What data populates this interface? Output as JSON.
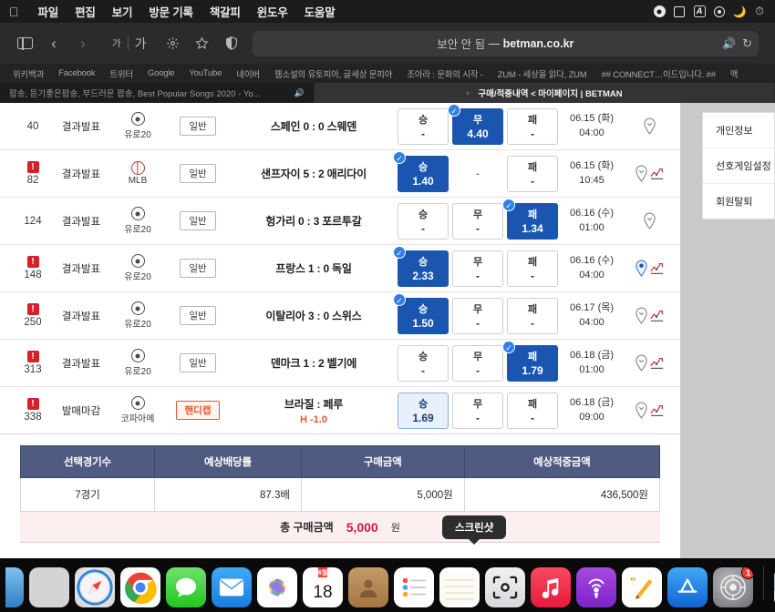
{
  "menubar": {
    "apple": "",
    "items": [
      "파일",
      "편집",
      "보기",
      "방문 기록",
      "책갈피",
      "윈도우",
      "도움말"
    ],
    "status_icons": [
      "record-icon",
      "screen-icon",
      "input-source-icon",
      "control-center-icon",
      "do-not-disturb-icon",
      "time-machine-icon"
    ]
  },
  "toolbar": {
    "sidebar_label": "사이드바",
    "back_label": "뒤로",
    "forward_label": "앞으로",
    "text_small": "가",
    "text_large": "가",
    "settings_label": "설정",
    "bookmark_label": "책갈피",
    "shield_label": "개인 정보 보호 리포트",
    "url_security": "보안 안 됨",
    "url_dash": "—",
    "url_domain": "betman.co.kr",
    "speaker_icon": "speaker-icon",
    "reload_icon": "reload-icon"
  },
  "bookmarks": [
    "위키백과",
    "Facebook",
    "트위터",
    "Google",
    "YouTube",
    "네이버",
    "웹소설의 유토피아, 글세상 문피아",
    "조아라 : 문화의 시작 -",
    "ZUM - 세상을 읽다, ZUM",
    "## CONNECT…이드입니다. ##",
    "맥"
  ],
  "tabs": [
    {
      "title": "팝송, 듣기좋은팝송, 부드러운 팝송, Best Popular Songs 2020 - Yo...",
      "active": false,
      "has_audio": true
    },
    {
      "title": "구매/적중내역 < 마이페이지 | BETMAN",
      "active": true,
      "has_audio": false
    }
  ],
  "match_rows": [
    {
      "no": "40",
      "alert": false,
      "status": "결과발표",
      "league": "유로20",
      "league_icon": "soccer-ball-icon",
      "type": "일반",
      "type_kind": "normal",
      "match": "스페인 0 : 0 스웨덴",
      "handicap": "",
      "odds": [
        {
          "label": "승",
          "value": "-",
          "state": "plain"
        },
        {
          "label": "무",
          "value": "4.40",
          "state": "selected"
        },
        {
          "label": "패",
          "value": "-",
          "state": "plain"
        }
      ],
      "date": "06.15 (화)",
      "time": "04:00",
      "actions": [
        "pin-icon"
      ]
    },
    {
      "no": "82",
      "alert": true,
      "status": "결과발표",
      "league": "MLB",
      "league_icon": "baseball-icon",
      "type": "일반",
      "type_kind": "normal",
      "match": "샌프자이 5 : 2 애리다이",
      "handicap": "",
      "odds": [
        {
          "label": "승",
          "value": "1.40",
          "state": "selected"
        },
        {
          "label": "",
          "value": "-",
          "state": "blank"
        },
        {
          "label": "패",
          "value": "-",
          "state": "plain"
        }
      ],
      "date": "06.15 (화)",
      "time": "10:45",
      "actions": [
        "pin-icon",
        "chart-icon"
      ]
    },
    {
      "no": "124",
      "alert": false,
      "status": "결과발표",
      "league": "유로20",
      "league_icon": "soccer-ball-icon",
      "type": "일반",
      "type_kind": "normal",
      "match": "헝가리 0 : 3 포르투갈",
      "handicap": "",
      "odds": [
        {
          "label": "승",
          "value": "-",
          "state": "plain"
        },
        {
          "label": "무",
          "value": "-",
          "state": "plain"
        },
        {
          "label": "패",
          "value": "1.34",
          "state": "selected"
        }
      ],
      "date": "06.16 (수)",
      "time": "01:00",
      "actions": [
        "pin-icon"
      ]
    },
    {
      "no": "148",
      "alert": true,
      "status": "결과발표",
      "league": "유로20",
      "league_icon": "soccer-ball-icon",
      "type": "일반",
      "type_kind": "normal",
      "match": "프랑스 1 : 0 독일",
      "handicap": "",
      "odds": [
        {
          "label": "승",
          "value": "2.33",
          "state": "selected"
        },
        {
          "label": "무",
          "value": "-",
          "state": "plain"
        },
        {
          "label": "패",
          "value": "-",
          "state": "plain"
        }
      ],
      "date": "06.16 (수)",
      "time": "04:00",
      "actions": [
        "pin-icon-active",
        "chart-icon"
      ]
    },
    {
      "no": "250",
      "alert": true,
      "status": "결과발표",
      "league": "유로20",
      "league_icon": "soccer-ball-icon",
      "type": "일반",
      "type_kind": "normal",
      "match": "이탈리아 3 : 0 스위스",
      "handicap": "",
      "odds": [
        {
          "label": "승",
          "value": "1.50",
          "state": "selected"
        },
        {
          "label": "무",
          "value": "-",
          "state": "plain"
        },
        {
          "label": "패",
          "value": "-",
          "state": "plain"
        }
      ],
      "date": "06.17 (목)",
      "time": "04:00",
      "actions": [
        "pin-icon",
        "chart-icon"
      ]
    },
    {
      "no": "313",
      "alert": true,
      "status": "결과발표",
      "league": "유로20",
      "league_icon": "soccer-ball-icon",
      "type": "일반",
      "type_kind": "normal",
      "match": "덴마크 1 : 2 벨기에",
      "handicap": "",
      "odds": [
        {
          "label": "승",
          "value": "-",
          "state": "plain"
        },
        {
          "label": "무",
          "value": "-",
          "state": "plain"
        },
        {
          "label": "패",
          "value": "1.79",
          "state": "selected"
        }
      ],
      "date": "06.18 (금)",
      "time": "01:00",
      "actions": [
        "pin-icon",
        "chart-icon"
      ]
    },
    {
      "no": "338",
      "alert": true,
      "status": "발매마감",
      "league": "코파아메",
      "league_icon": "soccer-ball-icon",
      "type": "핸디캡",
      "type_kind": "handicap",
      "match": "브라질 : 페루",
      "handicap": "H -1.0",
      "odds": [
        {
          "label": "승",
          "value": "1.69",
          "state": "soft"
        },
        {
          "label": "무",
          "value": "-",
          "state": "plain"
        },
        {
          "label": "패",
          "value": "-",
          "state": "plain"
        }
      ],
      "date": "06.18 (금)",
      "time": "09:00",
      "actions": [
        "pin-icon",
        "chart-icon"
      ]
    }
  ],
  "summary": {
    "headers": [
      "선택경기수",
      "예상배당률",
      "구매금액",
      "예상적중금액"
    ],
    "values": [
      "7경기",
      "87.3배",
      "5,000원",
      "436,500원"
    ]
  },
  "total": {
    "label": "총 구매금액",
    "amount": "5,000",
    "unit": "원"
  },
  "side_panel": {
    "items": [
      "개인정보",
      "선호게임설정",
      "회원탈퇴"
    ]
  },
  "tooltip": {
    "text": "스크린샷"
  },
  "dock": {
    "items": [
      {
        "name": "finder",
        "label": "Finder",
        "partial": true,
        "running": false
      },
      {
        "name": "launchpad",
        "label": "Launchpad",
        "running": false
      },
      {
        "name": "safari",
        "label": "Safari",
        "running": true
      },
      {
        "name": "chrome",
        "label": "Google Chrome",
        "running": false
      },
      {
        "name": "messages",
        "label": "메시지",
        "running": false
      },
      {
        "name": "mail",
        "label": "Mail",
        "running": false
      },
      {
        "name": "photos",
        "label": "사진",
        "running": false
      },
      {
        "name": "calendar",
        "label": "캘린더",
        "day": "18",
        "month": "6월",
        "running": false
      },
      {
        "name": "contacts",
        "label": "연락처",
        "running": false
      },
      {
        "name": "reminders",
        "label": "미리 알림",
        "running": false
      },
      {
        "name": "notes",
        "label": "메모",
        "running": false
      },
      {
        "name": "screenshot",
        "label": "스크린샷",
        "running": true
      },
      {
        "name": "music",
        "label": "음악",
        "running": false
      },
      {
        "name": "podcasts",
        "label": "팟캐스트",
        "running": false
      },
      {
        "name": "pages",
        "label": "Pages",
        "running": false
      },
      {
        "name": "appstore",
        "label": "App Store",
        "running": false
      },
      {
        "name": "systempreferences",
        "label": "시스템 환경설정",
        "badge": "1",
        "running": false
      },
      {
        "name": "finderwindow",
        "label": "미리보기 창",
        "running": false
      }
    ]
  },
  "colors": {
    "selected_odd": "#1a56b0",
    "alert_red": "#d2232a",
    "handicap_orange": "#e8552f",
    "summary_header": "#4f5b80",
    "total_amount": "#d01c3c",
    "accent_blue": "#2f7fe8"
  }
}
